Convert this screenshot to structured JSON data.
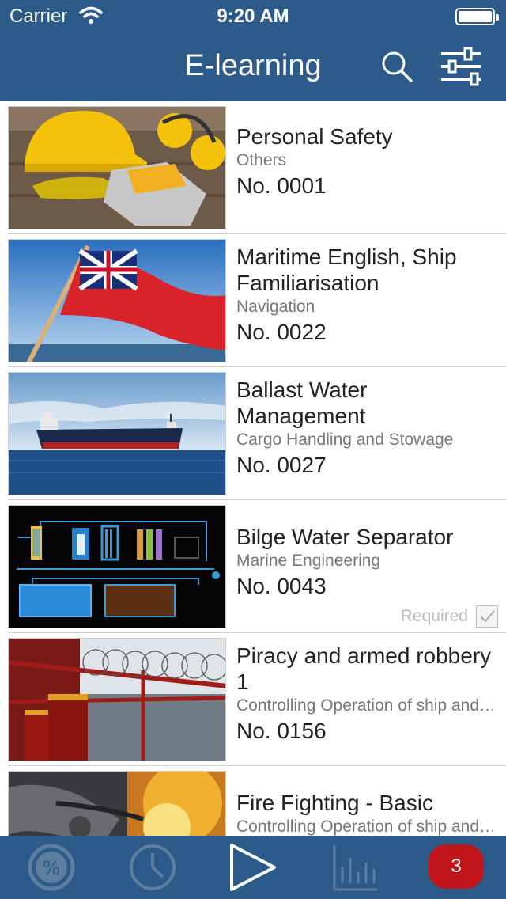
{
  "status_bar": {
    "carrier": "Carrier",
    "time": "9:20 AM"
  },
  "header": {
    "title": "E-learning",
    "search_icon": "search-icon",
    "filter_icon": "sliders-icon"
  },
  "courses": [
    {
      "title": "Personal Safety",
      "category": "Others",
      "number": "No. 0001",
      "image": "safety-gear-image"
    },
    {
      "title": "Maritime English, Ship Familiarisation",
      "category": "Navigation",
      "number": "No. 0022",
      "image": "red-ensign-flag-image"
    },
    {
      "title": "Ballast Water Management",
      "category": "Cargo Handling and Stowage",
      "number": "No. 0027",
      "image": "cargo-ship-image"
    },
    {
      "title": "Bilge Water Separator",
      "category": "Marine Engineering",
      "number": "No. 0043",
      "image": "separator-diagram-image",
      "required_label": "Required"
    },
    {
      "title": "Piracy and armed robbery 1",
      "category": "Controlling Operation of ship and…",
      "number": "No. 0156",
      "image": "razor-wire-deck-image"
    },
    {
      "title": "Fire Fighting - Basic",
      "category": "Controlling Operation of ship and…",
      "number": "",
      "image": "firefighter-image"
    }
  ],
  "tabbar": {
    "tabs": [
      "progress-icon",
      "history-icon",
      "play-icon",
      "statistics-icon"
    ],
    "badge_count": "3"
  },
  "colors": {
    "brand": "#2c5b8a",
    "badge": "#c0151b"
  }
}
